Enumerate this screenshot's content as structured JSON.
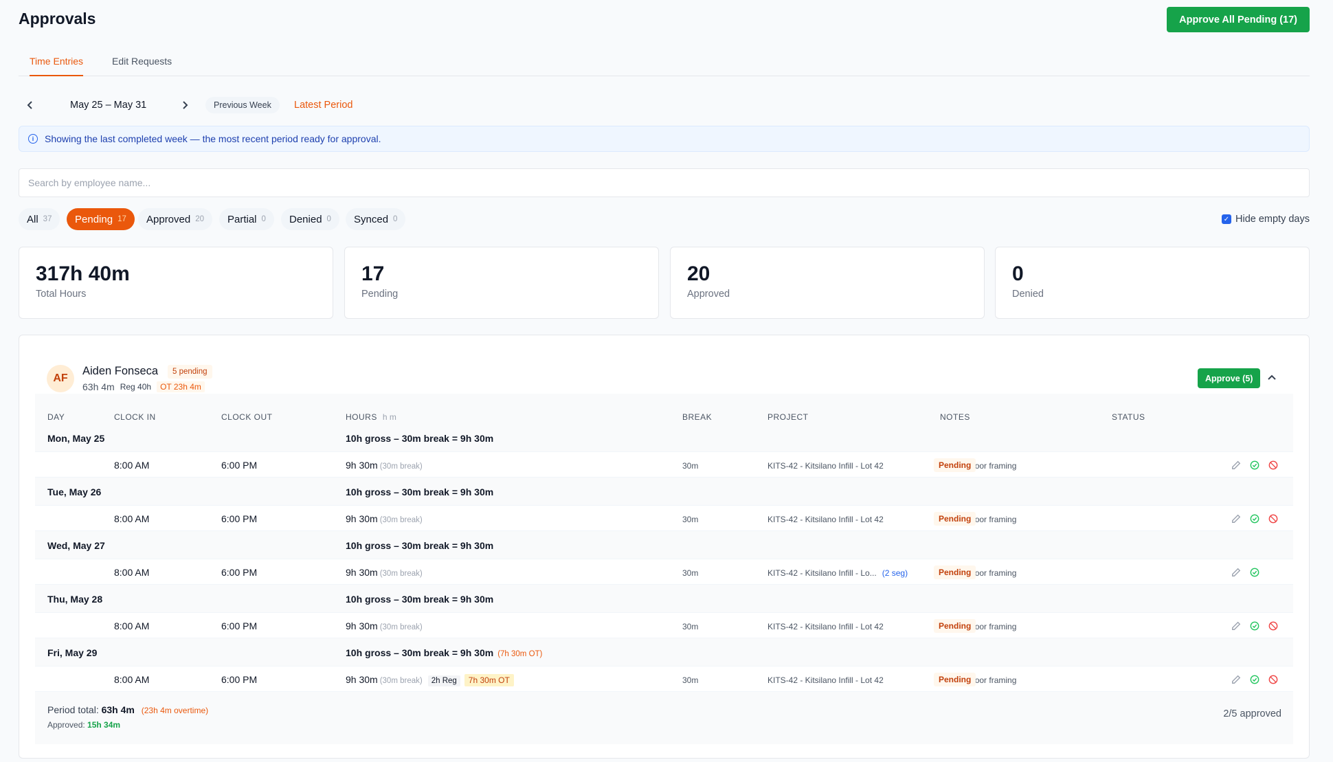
{
  "page": {
    "title": "Approvals",
    "approve_all_label": "Approve All Pending (17)"
  },
  "tabs": [
    {
      "label": "Time Entries",
      "active": true
    },
    {
      "label": "Edit Requests",
      "active": false
    }
  ],
  "period": {
    "label": "May 25 – May 31",
    "previous_week": "Previous Week",
    "latest_period": "Latest Period"
  },
  "info": {
    "text": "Showing the last completed week — the most recent period ready for approval."
  },
  "search": {
    "placeholder": "Search by employee name..."
  },
  "filters": [
    {
      "label": "All",
      "count": "37",
      "active": false
    },
    {
      "label": "Pending",
      "count": "17",
      "active": true
    },
    {
      "label": "Approved",
      "count": "20",
      "active": false
    },
    {
      "label": "Partial",
      "count": "0",
      "active": false
    },
    {
      "label": "Denied",
      "count": "0",
      "active": false
    },
    {
      "label": "Synced",
      "count": "0",
      "active": false
    }
  ],
  "hide_empty": {
    "label": "Hide empty days",
    "checked": true
  },
  "stats": [
    {
      "value": "317h 40m",
      "label": "Total Hours"
    },
    {
      "value": "17",
      "label": "Pending"
    },
    {
      "value": "20",
      "label": "Approved"
    },
    {
      "value": "0",
      "label": "Denied"
    }
  ],
  "employee": {
    "initials": "AF",
    "name": "Aiden Fonseca",
    "pending_badge": "5 pending",
    "total": "63h 4m",
    "reg": "Reg 40h",
    "ot": "OT 23h 4m",
    "approve_label": "Approve (5)"
  },
  "columns": {
    "day": "DAY",
    "clock_in": "CLOCK IN",
    "clock_out": "CLOCK OUT",
    "hours": "HOURS",
    "hours_unit": "h m",
    "break": "BREAK",
    "project": "PROJECT",
    "notes": "NOTES",
    "status": "STATUS"
  },
  "days": [
    {
      "day": "Mon, May 25",
      "summary": "10h gross – 30m break = 9h 30m",
      "ot_note": "",
      "entry": {
        "in": "8:00 AM",
        "out": "6:00 PM",
        "hours": "9h 30m",
        "break_note": "(30m break)",
        "reg": "",
        "ot": "",
        "break": "30m",
        "project": "KITS-42 - Kitsilano Infill - Lot 42",
        "seg": "",
        "notes": "Second-floor framing",
        "status": "Pending",
        "deny": true
      }
    },
    {
      "day": "Tue, May 26",
      "summary": "10h gross – 30m break = 9h 30m",
      "ot_note": "",
      "entry": {
        "in": "8:00 AM",
        "out": "6:00 PM",
        "hours": "9h 30m",
        "break_note": "(30m break)",
        "reg": "",
        "ot": "",
        "break": "30m",
        "project": "KITS-42 - Kitsilano Infill - Lot 42",
        "seg": "",
        "notes": "Second-floor framing",
        "status": "Pending",
        "deny": true
      }
    },
    {
      "day": "Wed, May 27",
      "summary": "10h gross – 30m break = 9h 30m",
      "ot_note": "",
      "entry": {
        "in": "8:00 AM",
        "out": "6:00 PM",
        "hours": "9h 30m",
        "break_note": "(30m break)",
        "reg": "",
        "ot": "",
        "break": "30m",
        "project": "KITS-42 - Kitsilano Infill - Lo...",
        "seg": "(2 seg)",
        "notes": "Second-floor framing",
        "status": "Pending",
        "deny": false
      }
    },
    {
      "day": "Thu, May 28",
      "summary": "10h gross – 30m break = 9h 30m",
      "ot_note": "",
      "entry": {
        "in": "8:00 AM",
        "out": "6:00 PM",
        "hours": "9h 30m",
        "break_note": "(30m break)",
        "reg": "",
        "ot": "",
        "break": "30m",
        "project": "KITS-42 - Kitsilano Infill - Lot 42",
        "seg": "",
        "notes": "Second-floor framing",
        "status": "Pending",
        "deny": true
      }
    },
    {
      "day": "Fri, May 29",
      "summary": "10h gross – 30m break = 9h 30m",
      "ot_note": "(7h 30m OT)",
      "entry": {
        "in": "8:00 AM",
        "out": "6:00 PM",
        "hours": "9h 30m",
        "break_note": "(30m break)",
        "reg": "2h Reg",
        "ot": "7h 30m OT",
        "break": "30m",
        "project": "KITS-42 - Kitsilano Infill - Lot 42",
        "seg": "",
        "notes": "Second-floor framing",
        "status": "Pending",
        "deny": true
      }
    }
  ],
  "totals": {
    "period_label": "Period total:",
    "period_value": "63h 4m",
    "overtime_note": "(23h 4m overtime)",
    "approved_label": "Approved:",
    "approved_value": "15h 34m",
    "ratio": "2/5 approved"
  },
  "colors": {
    "accent": "#ea580c",
    "success": "#16a34a",
    "info_bg": "#eff6ff"
  }
}
